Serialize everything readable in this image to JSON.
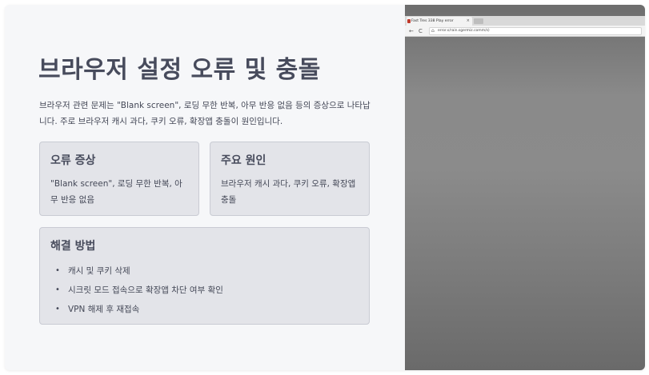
{
  "slide": {
    "title": "브라우저 설정 오류 및 충돌",
    "intro": "브라우저 관련 문제는 \"Blank screen\", 로딩 무한 반복, 아무 반응 없음 등의 증상으로 나타납니다. 주로 브라우저 캐시 과다, 쿠키 오류, 확장앱 충돌이 원인입니다.",
    "cards": {
      "symptom": {
        "title": "오류 증상",
        "body": "\"Blank screen\", 로딩 무한 반복, 아무 반응 없음"
      },
      "cause": {
        "title": "주요 원인",
        "body": "브라우저 캐시 과다, 쿠키 오류, 확장앱 충돌"
      },
      "fix": {
        "title": "해결 방법",
        "items": [
          "캐시 및 쿠키 삭제",
          "시크릿 모드 접속으로 확장앱 차단 여부 확인",
          "VPN 해제 후 재접속"
        ]
      }
    }
  },
  "screenshot": {
    "tab_title": "Fast Tres 338 Play error",
    "tab_close": "×",
    "url": "error.s/rain.sgermiz.comm/s)",
    "back_icon": "←",
    "reload_icon": "C",
    "home_icon": "⌂"
  }
}
